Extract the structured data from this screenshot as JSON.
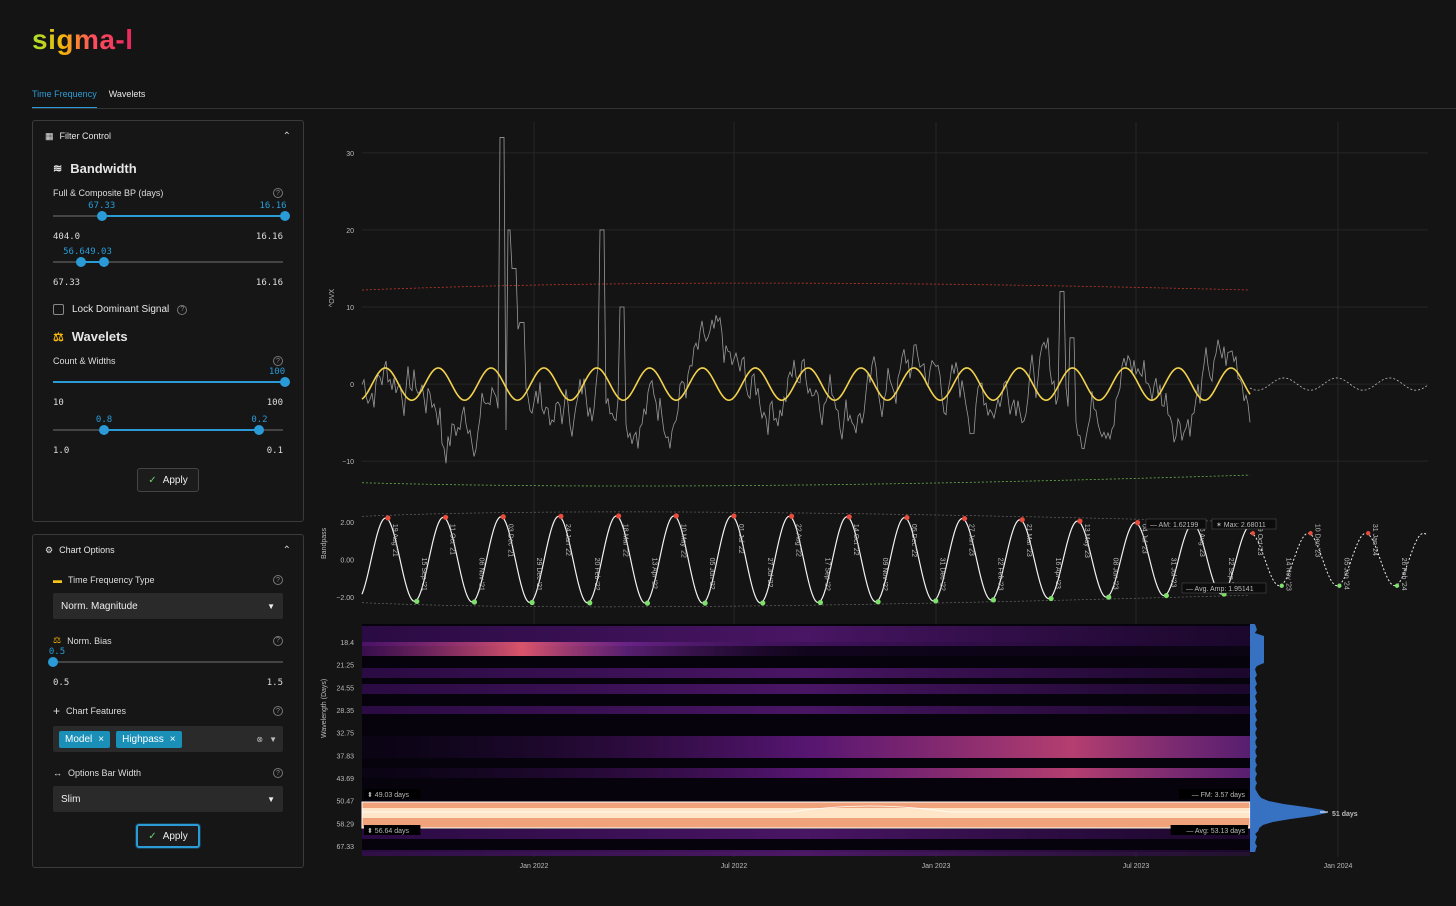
{
  "app": {
    "logo": "sigma-l"
  },
  "tabs": [
    {
      "label": "Time Frequency"
    },
    {
      "label": "Wavelets"
    }
  ],
  "filter_control": {
    "title": "Filter Control",
    "bandwidth": {
      "title": "Bandwidth",
      "label": "Full & Composite BP (days)",
      "slider1": {
        "low_label": "67.33",
        "high_label": "16.16",
        "min": "404.0",
        "max": "16.16",
        "low_frac": 0.21,
        "high_frac": 1.0
      },
      "slider2": {
        "label": "56.649.03",
        "min": "67.33",
        "max": "16.16",
        "low_frac": 0.12,
        "high_frac": 0.22
      }
    },
    "lock_label": "Lock Dominant Signal",
    "wavelets": {
      "title": "Wavelets",
      "label": "Count & Widths",
      "count": {
        "value": "100",
        "min": "10",
        "max": "100",
        "frac": 1.0
      },
      "widths": {
        "low_label": "0.8",
        "high_label": "0.2",
        "min": "1.0",
        "max": "0.1",
        "low_frac": 0.22,
        "high_frac": 0.89
      }
    },
    "apply": "Apply"
  },
  "chart_options": {
    "title": "Chart Options",
    "tf_type_label": "Time Frequency Type",
    "tf_type_value": "Norm. Magnitude",
    "bias_label": "Norm. Bias",
    "bias": {
      "value": "0.5",
      "min": "0.5",
      "max": "1.5",
      "frac": 0.0
    },
    "features_label": "Chart Features",
    "features": [
      "Model",
      "Highpass"
    ],
    "bar_width_label": "Options Bar Width",
    "bar_width_value": "Slim",
    "apply": "Apply"
  },
  "chart_data": [
    {
      "type": "line",
      "ylabel": "^OVX",
      "yticks": [
        30,
        20,
        10,
        0,
        -10
      ],
      "ylim": [
        -14,
        34
      ],
      "series": [
        {
          "type": "price",
          "color": "#9a9a9a"
        },
        {
          "type": "model",
          "color": "#f2d24c",
          "period_days": 53,
          "amplitude": 2.0
        },
        {
          "type": "upper-envelope",
          "color": "#c0392b",
          "level": 12.8
        },
        {
          "type": "lower-envelope",
          "color": "#6ab04c",
          "level": -12.5
        }
      ]
    },
    {
      "type": "line",
      "ylabel": "Bandpass",
      "yticks": [
        "2.00",
        "0.00",
        "−2.00"
      ],
      "ylim": [
        -2.8,
        2.8
      ],
      "annotations": {
        "am": "AM: 1.62199",
        "max": "Max: 2.68011",
        "avg_amp": "Avg. Amp: 1.95141"
      },
      "peak_labels": [
        "19 Aug '21",
        "15 Sep '21",
        "11 Oct '21",
        "06 Nov '21",
        "03 Dec '21",
        "29 Dec '21",
        "24 Jan '22",
        "20 Feb '22",
        "18 Mar '22",
        "13 Apr '22",
        "10 May '22",
        "05 Jun '22",
        "01 Jul '22",
        "27 Jul '22",
        "22 Aug '22",
        "17 Sep '22",
        "14 Oct '22",
        "09 Nov '22",
        "05 Dec '22",
        "31 Dec '22",
        "27 Jan '23",
        "22 Feb '23",
        "21 Mar '23",
        "16 Apr '23",
        "13 May '23",
        "08 Jun '23",
        "04 Jul '23",
        "31 Jul '23",
        "26 Aug '23",
        "22 Sep '23",
        "19 Oct '23",
        "14 Nov '23",
        "10 Dec '23",
        "05 Jan '24",
        "31 Jan '24",
        "26 Feb '24"
      ]
    },
    {
      "type": "heatmap",
      "ylabel": "Wavelength (Days)",
      "yticks": [
        "18.4",
        "21.25",
        "24.55",
        "28.35",
        "32.75",
        "37.83",
        "43.69",
        "50.47",
        "58.29",
        "67.33"
      ],
      "xticks": [
        "Jan 2022",
        "Jul 2022",
        "Jan 2023",
        "Jul 2023",
        "Jan 2024"
      ],
      "band_labels": {
        "top_left": "49.03 days",
        "bottom_left": "56.64 days",
        "top_right": "FM: 3.57 days",
        "bottom_right": "Avg: 53.13 days"
      },
      "dominant": "51 days"
    }
  ]
}
